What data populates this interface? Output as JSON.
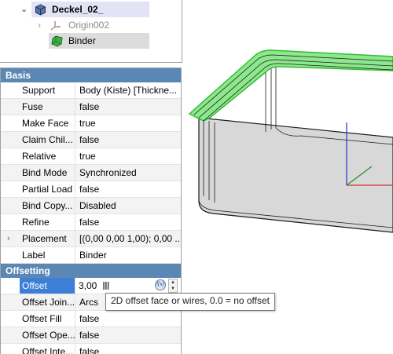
{
  "tree": {
    "items": [
      {
        "label": "Deckel_02_",
        "icon": "body-icon"
      },
      {
        "label": "Origin002",
        "icon": "origin-icon"
      },
      {
        "label": "Binder",
        "icon": "binder-icon"
      }
    ]
  },
  "properties": {
    "groups": [
      {
        "title": "Basis",
        "rows": [
          {
            "name": "Support",
            "value": "Body (Kiste) [Thickne..."
          },
          {
            "name": "Fuse",
            "value": "false"
          },
          {
            "name": "Make Face",
            "value": "true"
          },
          {
            "name": "Claim Chil...",
            "value": "false"
          },
          {
            "name": "Relative",
            "value": "true"
          },
          {
            "name": "Bind Mode",
            "value": "Synchronized"
          },
          {
            "name": "Partial Load",
            "value": "false"
          },
          {
            "name": "Bind Copy...",
            "value": "Disabled"
          },
          {
            "name": "Refine",
            "value": "false"
          },
          {
            "name": "Placement",
            "value": "[(0,00 0,00 1,00); 0,00 ..."
          },
          {
            "name": "Label",
            "value": "Binder"
          }
        ]
      },
      {
        "title": "Offsetting",
        "rows": [
          {
            "name": "Offset",
            "value": "3,00"
          },
          {
            "name": "Offset Join...",
            "value": "Arcs"
          },
          {
            "name": "Offset Fill",
            "value": "false"
          },
          {
            "name": "Offset Ope...",
            "value": "false"
          },
          {
            "name": "Offset Inte...",
            "value": "false"
          }
        ]
      }
    ]
  },
  "tooltip": {
    "text": "2D offset face or wires, 0.0 = no offset"
  },
  "colors": {
    "selection_bg": "#e3e3f5",
    "group_header": "#5b87b4",
    "active_cell": "#3d7fd6",
    "binder_green": "#7fe07f"
  }
}
